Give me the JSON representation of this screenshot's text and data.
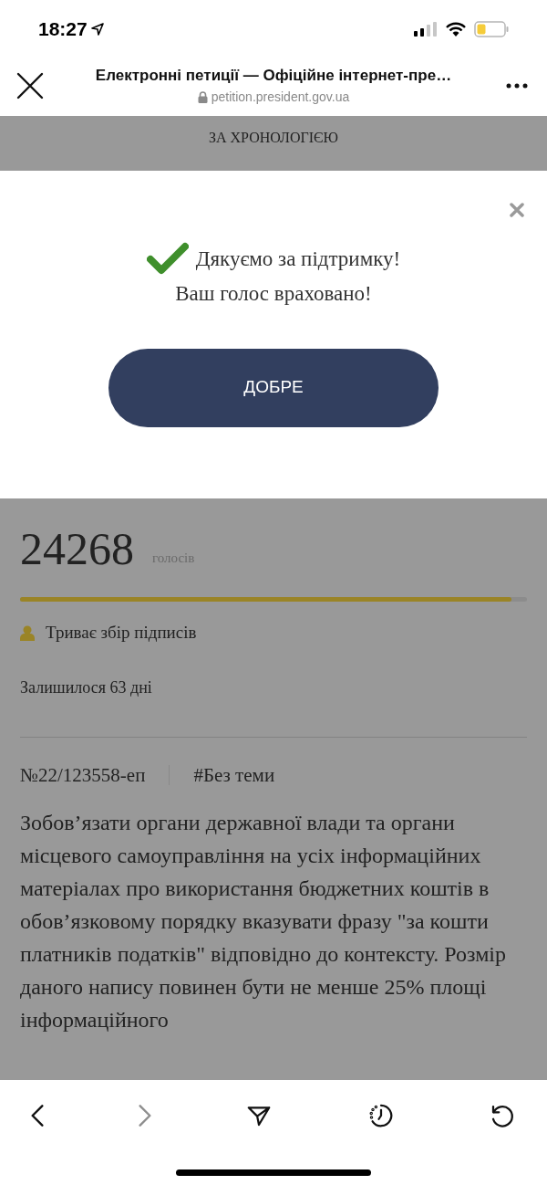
{
  "status_bar": {
    "time": "18:27"
  },
  "browser": {
    "title": "Електронні петиції — Офіційне інтернет-пре…",
    "url": "petition.president.gov.ua"
  },
  "page": {
    "sort_option": "ЗА ХРОНОЛОГІЄЮ",
    "votes": {
      "count": "24268",
      "unit": "голосів",
      "level": 0.97
    },
    "status": "Триває збір підписів",
    "remaining": "Залишилося 63 дні",
    "number": "№22/123558-еп",
    "tag": "#Без теми",
    "text": "Зобов’язати органи державної влади та органи місцевого самоуправління на усіх інформаційних матеріалах про використання бюджетних коштів в обов’язковому порядку вказувати фразу \"за кошти платників податків\" відповідно до контексту. Розмір даного напису повинен бути не менше 25% площі інформаційного"
  },
  "dialog": {
    "message_lines": [
      "Дякуємо за підтримку!",
      "Ваш голос враховано!"
    ],
    "button": "ДОБРЕ"
  },
  "toolbar": [
    {
      "kind": "back",
      "disabled": false
    },
    {
      "kind": "forward",
      "disabled": true
    },
    {
      "kind": "share",
      "disabled": false
    },
    {
      "kind": "history",
      "disabled": false
    },
    {
      "kind": "reload",
      "disabled": false
    }
  ]
}
